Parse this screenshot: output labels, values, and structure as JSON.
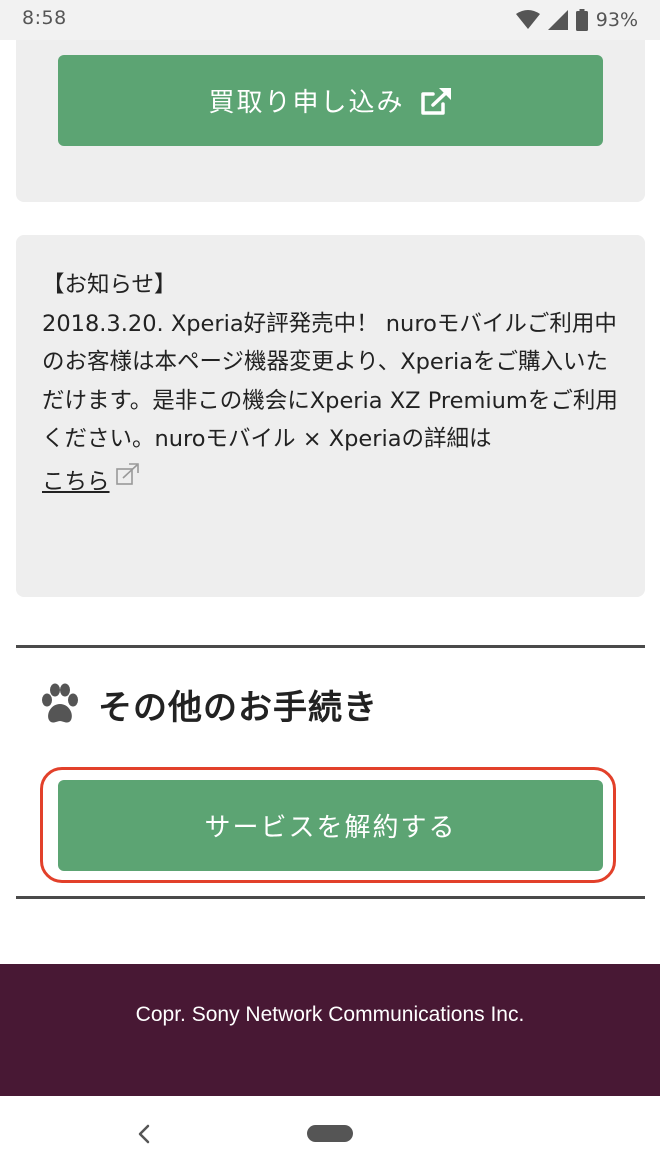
{
  "status_bar": {
    "time": "8:58",
    "battery_percent": "93%",
    "icons": [
      "wifi-icon",
      "signal-icon",
      "battery-icon"
    ]
  },
  "purchase_card": {
    "button_label": "買取り申し込み",
    "button_icon": "external-link-icon"
  },
  "notice": {
    "heading": "【お知らせ】",
    "body": "2018.3.20. Xperia好評発売中！ nuroモバイルご利用中のお客様は本ページ機器変更より、Xperiaをご購入いただけます。是非この機会にXperia XZ Premiumをご利用ください。nuroモバイル × Xperiaの詳細は",
    "link_label": "こちら",
    "link_icon": "external-link-icon"
  },
  "other_procedures": {
    "title": "その他のお手続き",
    "title_icon": "paw-icon",
    "cancel_button_label": "サービスを解約する"
  },
  "footer": {
    "copyright": "Copr. Sony Network Communications Inc."
  },
  "nav_bar": {
    "icons": [
      "back-icon",
      "home-pill-icon"
    ]
  },
  "colors": {
    "button_green": "#5ca473",
    "card_gray": "#eeeeee",
    "footer_purple": "#481834",
    "highlight_red": "#e2402a"
  }
}
